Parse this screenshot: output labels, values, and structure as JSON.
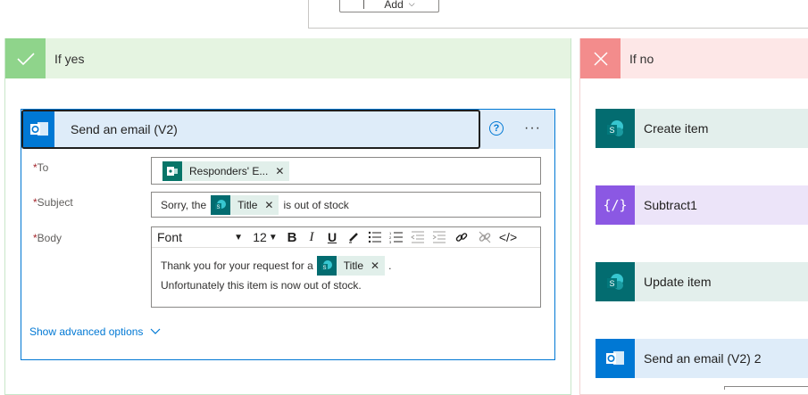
{
  "top": {
    "add_label": "Add"
  },
  "yes_branch": {
    "label": "If yes"
  },
  "no_branch": {
    "label": "If no"
  },
  "email_card": {
    "title": "Send an email (V2)",
    "to": {
      "label": "To",
      "token": "Responders' E..."
    },
    "subject": {
      "label": "Subject",
      "prefix": "Sorry, the",
      "token": "Title",
      "suffix": "is out of stock"
    },
    "body": {
      "label": "Body",
      "toolbar": {
        "font": "Font",
        "size": "12"
      },
      "line1_prefix": "Thank you for your request for a",
      "token": "Title",
      "line1_suffix": ".",
      "line2": "Unfortunately this item is now out of stock."
    },
    "show_advanced": "Show advanced options"
  },
  "no_actions": [
    {
      "label": "Create item",
      "color": "#e3efec",
      "icon": "sharepoint-icon"
    },
    {
      "label": "Subtract1",
      "color": "#ece4f9",
      "icon": "variable-icon"
    },
    {
      "label": "Update item",
      "color": "#e3efec",
      "icon": "sharepoint-icon"
    },
    {
      "label": "Send an email (V2) 2",
      "color": "#deecf9",
      "icon": "outlook-icon"
    }
  ]
}
